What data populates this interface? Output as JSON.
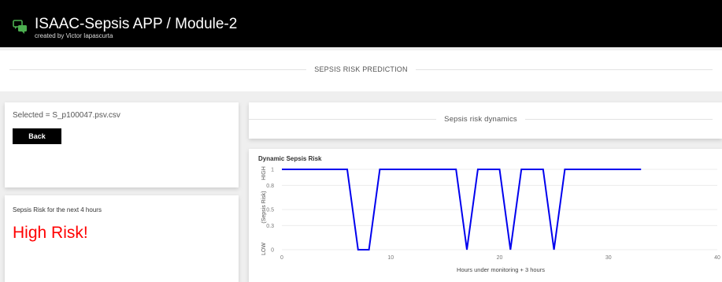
{
  "header": {
    "title": "ISAAC-Sepsis APP / Module-2",
    "subtitle": "created by Victor Iapascurta",
    "logo_icon": "chat-bubbles-icon",
    "background": "#000000"
  },
  "section": {
    "title": "SEPSIS RISK PREDICTION"
  },
  "file_panel": {
    "selected_text": "Selected = S_p100047.psv.csv",
    "back_label": "Back"
  },
  "risk_panel": {
    "label": "Sepsis Risk for the next 4 hours",
    "value": "High Risk!",
    "value_color": "#ff0000"
  },
  "dynamics_panel": {
    "title": "Sepsis risk dynamics"
  },
  "chart_data": {
    "type": "line",
    "title": "Dynamic Sepsis Risk",
    "xlabel": "Hours under monitoring + 3 hours",
    "ylabel_low": "LOW",
    "ylabel_mid": "(Sepsis Risk)",
    "ylabel_high": "HIGH",
    "xlim": [
      0,
      40
    ],
    "ylim": [
      0,
      1
    ],
    "x_ticks": [
      0,
      10,
      20,
      30,
      40
    ],
    "y_ticks": [
      0,
      0.3,
      0.5,
      0.8,
      1
    ],
    "grid": true,
    "line_color": "#0000ee",
    "x": [
      0,
      1,
      2,
      3,
      4,
      5,
      6,
      7,
      8,
      9,
      10,
      11,
      12,
      13,
      14,
      15,
      16,
      17,
      18,
      19,
      20,
      21,
      22,
      23,
      24,
      25,
      26,
      27,
      28,
      29,
      30,
      31,
      32,
      33
    ],
    "y": [
      1,
      1,
      1,
      1,
      1,
      1,
      1,
      0,
      0,
      1,
      1,
      1,
      1,
      1,
      1,
      1,
      1,
      0,
      1,
      1,
      1,
      0,
      1,
      1,
      1,
      0,
      1,
      1,
      1,
      1,
      1,
      1,
      1,
      1
    ]
  }
}
